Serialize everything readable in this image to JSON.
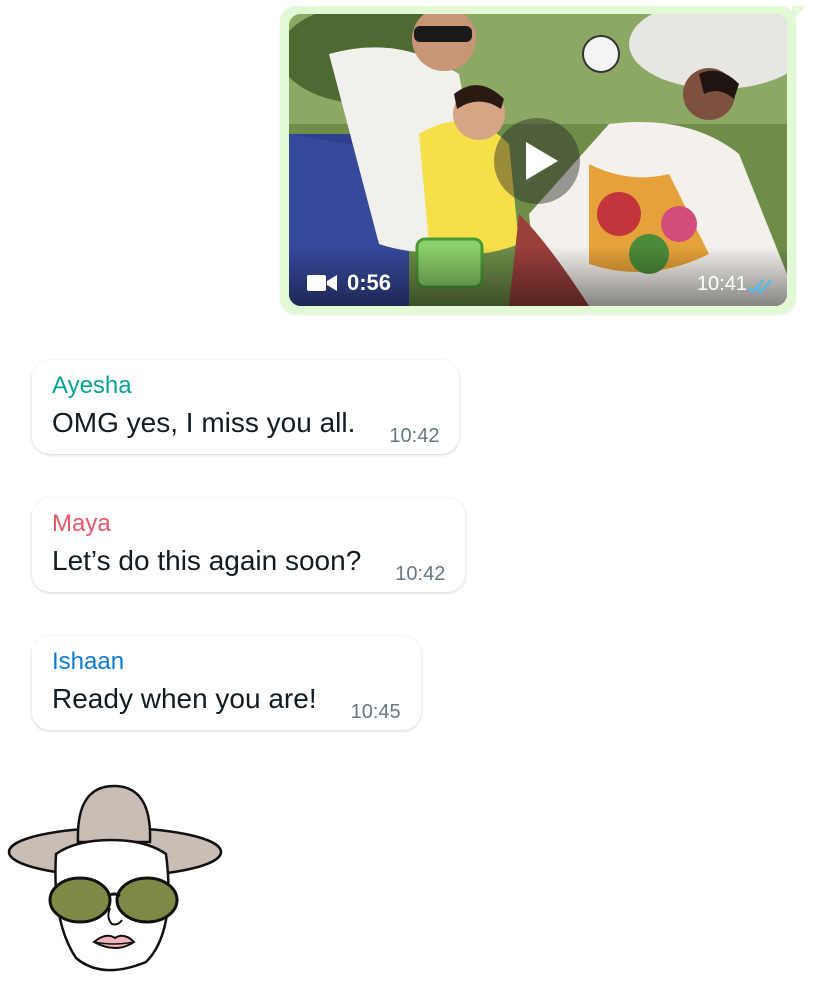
{
  "video_message": {
    "duration": "0:56",
    "time": "10:41",
    "status": "read",
    "icons": {
      "camera": "video-camera-icon",
      "play": "play-icon",
      "ticks": "double-check-icon"
    },
    "colors": {
      "bubble": "#e3f8d4",
      "ticks": "#53bdeb"
    }
  },
  "messages": [
    {
      "sender": "Ayesha",
      "sender_color": "#06a298",
      "text": "OMG yes, I miss you all.",
      "time": "10:42"
    },
    {
      "sender": "Maya",
      "sender_color": "#e8566b",
      "text": "Let’s do this again soon?",
      "time": "10:42"
    },
    {
      "sender": "Ishaan",
      "sender_color": "#0a7cd6",
      "text": "Ready when you are!",
      "time": "10:45"
    }
  ],
  "avatar": {
    "icon": "woman-sunhat-sunglasses-avatar-icon"
  }
}
